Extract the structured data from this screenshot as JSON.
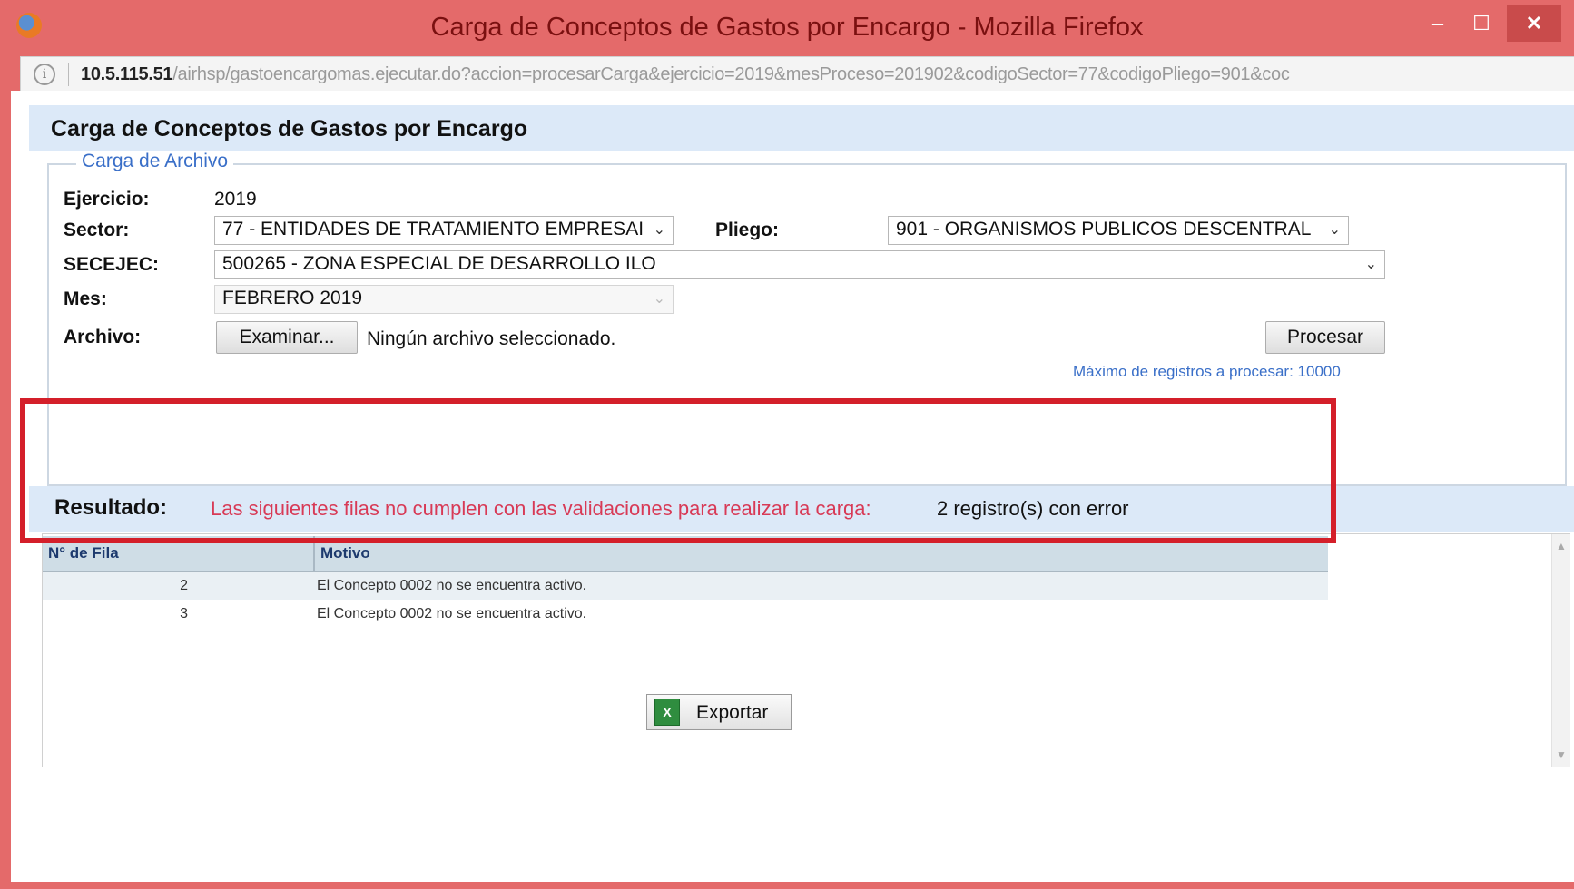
{
  "window": {
    "title": "Carga de Conceptos de Gastos por Encargo - Mozilla Firefox",
    "min": "–",
    "max": "☐",
    "close": "✕"
  },
  "urlbar": {
    "host": "10.5.115.51",
    "path": "/airhsp/gastoencargomas.ejecutar.do?accion=procesarCarga&ejercicio=2019&mesProceso=201902&codigoSector=77&codigoPliego=901&coc"
  },
  "page": {
    "title": "Carga de Conceptos de Gastos por Encargo"
  },
  "form": {
    "legend": "Carga de Archivo",
    "ejercicio_label": "Ejercicio:",
    "ejercicio_value": "2019",
    "sector_label": "Sector:",
    "sector_value": "77 - ENTIDADES DE TRATAMIENTO EMPRESAI",
    "pliego_label": "Pliego:",
    "pliego_value": "901 - ORGANISMOS PUBLICOS DESCENTRAL",
    "secejec_label": "SECEJEC:",
    "secejec_value": "500265 - ZONA ESPECIAL DE DESARROLLO ILO",
    "mes_label": "Mes:",
    "mes_value": "FEBRERO 2019",
    "archivo_label": "Archivo:",
    "examinar_label": "Examinar...",
    "file_status": "Ningún archivo seleccionado.",
    "procesar_label": "Procesar",
    "max_note": "Máximo de registros a procesar: 10000"
  },
  "result": {
    "title": "Resultado:",
    "message": "Las siguientes filas no cumplen con las validaciones para realizar la carga:",
    "count": "2 registro(s) con error",
    "columns": [
      "N° de Fila",
      "Motivo"
    ],
    "rows": [
      {
        "fila": "2",
        "motivo": "El Concepto 0002 no se encuentra activo."
      },
      {
        "fila": "3",
        "motivo": "El Concepto 0002 no se encuentra activo."
      }
    ]
  },
  "export": {
    "label": "Exportar",
    "icon_glyph": "X"
  },
  "colors": {
    "window_frame": "#e46a6a",
    "header_bg": "#dce9f8",
    "error_text": "#d83a56",
    "highlight_border": "#d41f2a",
    "link": "#3a6fc8"
  }
}
